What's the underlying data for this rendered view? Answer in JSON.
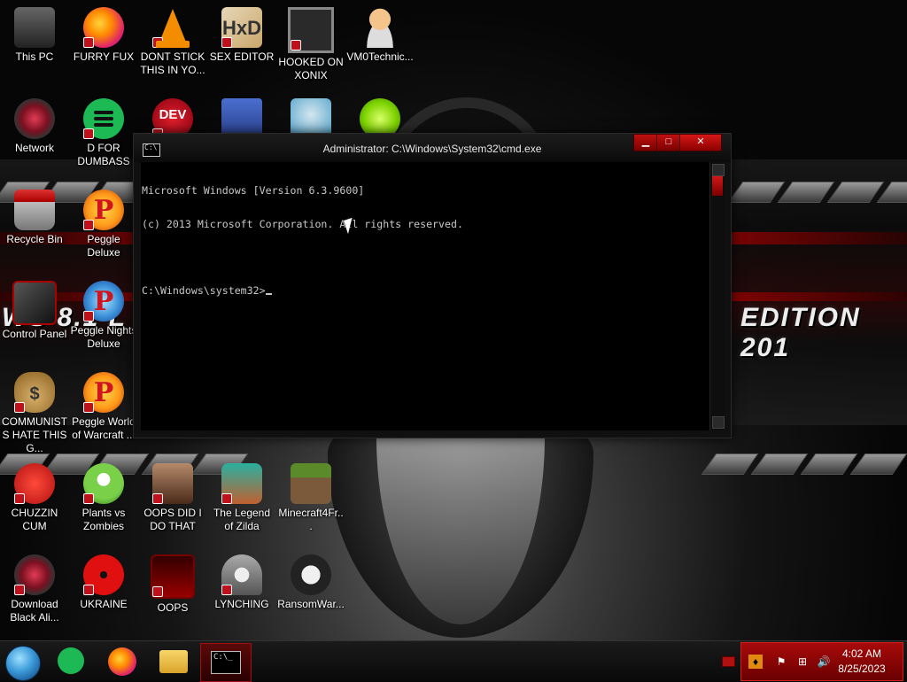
{
  "desktop": {
    "wallpaper_text_left": "WS 8.1 L",
    "wallpaper_text_right": "EDITION 201",
    "icons": [
      {
        "label": "This PC",
        "icon": "computer-icon"
      },
      {
        "label": "FURRY FUX",
        "icon": "firefox-icon"
      },
      {
        "label": "DONT STICK THIS IN YO...",
        "icon": "vlc-icon"
      },
      {
        "label": "SEX EDITOR",
        "icon": "hex-editor-icon"
      },
      {
        "label": "HOOKED ON XONIX",
        "icon": "maze-game-icon"
      },
      {
        "label": "VM0Technic...",
        "icon": "user-icon"
      },
      {
        "label": "Network",
        "icon": "network-icon"
      },
      {
        "label": "D FOR DUMBASS",
        "icon": "spotify-icon"
      },
      {
        "label": "",
        "icon": "dev-cpp-icon"
      },
      {
        "label": "",
        "icon": "card-icon"
      },
      {
        "label": "",
        "icon": "santa-icon"
      },
      {
        "label": "",
        "icon": "limewire-icon"
      },
      {
        "label": "Recycle Bin",
        "icon": "recycle-bin-icon"
      },
      {
        "label": "Peggle Deluxe",
        "icon": "peggle-icon"
      },
      {
        "label": "Control Panel",
        "icon": "control-panel-icon"
      },
      {
        "label": "Peggle Nights Deluxe",
        "icon": "peggle-nights-icon"
      },
      {
        "label": "COMMUNISTS HATE THIS G...",
        "icon": "money-bag-icon"
      },
      {
        "label": "Peggle World of Warcraft ...",
        "icon": "peggle-wow-icon"
      },
      {
        "label": "CHUZZIN CUM",
        "icon": "chuzzle-icon"
      },
      {
        "label": "Plants vs Zombies",
        "icon": "plants-vs-zombies-icon"
      },
      {
        "label": "OOPS DID I DO THAT",
        "icon": "portrait-icon"
      },
      {
        "label": "The Legend of Zilda",
        "icon": "zelda-icon"
      },
      {
        "label": "Minecraft4Fr...",
        "icon": "minecraft-icon"
      },
      {
        "label": "Download Black Ali...",
        "icon": "network-icon"
      },
      {
        "label": "UKRAINE",
        "icon": "radiation-icon"
      },
      {
        "label": "OOPS",
        "icon": "app-icon"
      },
      {
        "label": "LYNCHING",
        "icon": "lynching-icon"
      },
      {
        "label": "RansomWar...",
        "icon": "skull-icon"
      }
    ],
    "dev_badge": "DEV",
    "hxd_badge": "HxD",
    "money_badge": "$"
  },
  "cmd": {
    "title": "Administrator: C:\\Windows\\System32\\cmd.exe",
    "icon_glyph": "C:\\",
    "buttons": {
      "minimize": "▁",
      "maximize": "□",
      "close": "✕"
    },
    "lines": [
      "Microsoft Windows [Version 6.3.9600]",
      "(c) 2013 Microsoft Corporation. All rights reserved.",
      "",
      "C:\\Windows\\system32>"
    ]
  },
  "taskbar": {
    "items": [
      "start-orb",
      "spotify",
      "firefox",
      "file-explorer",
      "command-prompt"
    ],
    "cmd_glyph": "C:\\_",
    "tray": {
      "icons": [
        "flag-icon",
        "network-icon",
        "volume-icon"
      ],
      "time": "4:02 AM",
      "date": "8/25/2023"
    }
  },
  "colors": {
    "accent_red": "#a80a0a",
    "console_bg": "#000000",
    "console_text": "#c8c8c8"
  }
}
